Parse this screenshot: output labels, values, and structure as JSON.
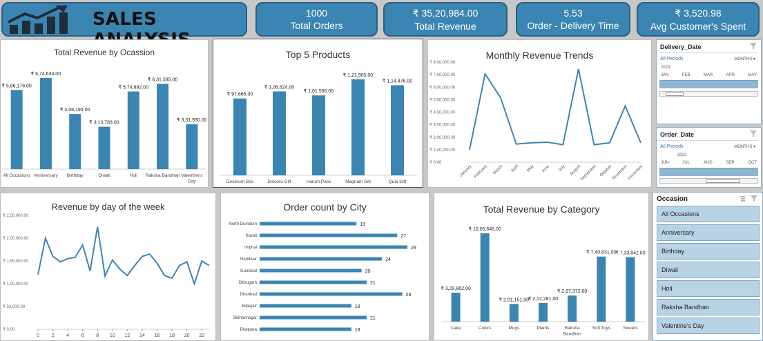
{
  "header": {
    "title": "SALES ANALYSIS",
    "kpis": [
      {
        "value": "1000",
        "label": "Total Orders"
      },
      {
        "value": "₹ 35,20,984.00",
        "label": "Total Revenue"
      },
      {
        "value": "5.53",
        "label": "Order - Delivery Time"
      },
      {
        "value": "₹ 3,520.98",
        "label": "Avg Customer's Spent"
      }
    ]
  },
  "colors": {
    "bar": "#3b85b2",
    "kpi_bg": "#3b85b2",
    "slicer_item": "#b9d3e6"
  },
  "charts": {
    "occasion": {
      "title": "Total Revenue by Ocassion",
      "categories": [
        "All Occasions",
        "Anniversary",
        "Birthday",
        "Diwali",
        "Holi",
        "Raksha Bandhan",
        "Valentine's Day"
      ],
      "values": [
        586176,
        674634,
        408194,
        313783,
        574682,
        631585,
        331930
      ],
      "labels": [
        "₹ 5,86,176.00",
        "₹ 6,74,634.00",
        "₹ 4,08,194.00",
        "₹ 3,13,783.00",
        "₹ 5,74,682.00",
        "₹ 6,31,585.00",
        "₹ 3,31,930.00"
      ]
    },
    "products": {
      "title": "Top 5 Products",
      "categories": [
        "Deserunt Box",
        "Dolores Gift",
        "Harum Pack",
        "Magnam Set",
        "Quia Gift"
      ],
      "values": [
        97665,
        106624,
        101556,
        121905,
        114476
      ],
      "labels": [
        "₹ 97,665.00",
        "₹ 1,06,624.00",
        "₹ 1,01,556.00",
        "₹ 1,21,905.00",
        "₹ 1,14,476.00"
      ]
    },
    "monthly": {
      "title": "Monthly Revenue Trends",
      "categories": [
        "January",
        "February",
        "March",
        "April",
        "May",
        "June",
        "July",
        "August",
        "September",
        "October",
        "November",
        "December"
      ],
      "values": [
        100000,
        705000,
        515000,
        145000,
        155000,
        160000,
        140000,
        745000,
        140000,
        155000,
        450000,
        155000
      ],
      "yticks": [
        "₹ 0.00",
        "₹ 1,00,000.00",
        "₹ 2,00,000.00",
        "₹ 3,00,000.00",
        "₹ 4,00,000.00",
        "₹ 5,00,000.00",
        "₹ 6,00,000.00",
        "₹ 7,00,000.00",
        "₹ 8,00,000.00"
      ],
      "ylim": [
        0,
        800000
      ]
    },
    "weekday": {
      "title": "Revenue by day of the week",
      "x": [
        0,
        1,
        2,
        3,
        4,
        5,
        6,
        7,
        8,
        9,
        10,
        11,
        12,
        13,
        14,
        15,
        16,
        17,
        18,
        19,
        20,
        21,
        22,
        23
      ],
      "values": [
        120000,
        200000,
        160000,
        148000,
        155000,
        158000,
        185000,
        128000,
        225000,
        117000,
        152000,
        132000,
        118000,
        140000,
        160000,
        165000,
        145000,
        118000,
        112000,
        140000,
        148000,
        100000,
        150000,
        140000
      ],
      "xticks": [
        "0",
        "2",
        "4",
        "6",
        "8",
        "10",
        "12",
        "14",
        "16",
        "18",
        "20",
        "22"
      ],
      "yticks": [
        "₹ 0.00",
        "₹ 50,000.00",
        "₹ 1,00,000.00",
        "₹ 1,50,000.00",
        "₹ 2,00,000.00",
        "₹ 2,50,000.00"
      ],
      "ylim": [
        0,
        250000
      ]
    },
    "city": {
      "title": "Order count by City",
      "categories": [
        "North Dumdum",
        "Kavali",
        "Imphal",
        "Haridwar",
        "Guntakal",
        "Dibrugarh",
        "Dhanbad",
        "Bilaspur",
        "Bidhannagar",
        "Bhatpara"
      ],
      "values": [
        19,
        27,
        29,
        24,
        20,
        21,
        28,
        18,
        21,
        18
      ],
      "labels": [
        "19",
        "27",
        "29",
        "24",
        "20",
        "21",
        "28",
        "18",
        "21",
        "18"
      ]
    },
    "category": {
      "title": "Total Revenue by Category",
      "categories": [
        "Cake",
        "Colors",
        "Mugs",
        "Plants",
        "Raksha Bandhan",
        "Soft Toys",
        "Sweets"
      ],
      "values": [
        329862,
        1005645,
        201151,
        212281,
        297372,
        740831,
        733842
      ],
      "labels": [
        "₹ 3,29,862.00",
        "₹ 10,05,645.00",
        "₹ 2,01,151.00",
        "₹ 2,12,281.00",
        "₹ 2,97,372.00",
        "₹ 7,40,831.00",
        "₹ 7,33,842.00"
      ]
    }
  },
  "chart_data": [
    {
      "type": "bar",
      "title": "Total Revenue by Ocassion",
      "categories": [
        "All Occasions",
        "Anniversary",
        "Birthday",
        "Diwali",
        "Holi",
        "Raksha Bandhan",
        "Valentine's Day"
      ],
      "values": [
        586176,
        674634,
        408194,
        313783,
        574682,
        631585,
        331930
      ]
    },
    {
      "type": "bar",
      "title": "Top 5 Products",
      "categories": [
        "Deserunt Box",
        "Dolores Gift",
        "Harum Pack",
        "Magnam Set",
        "Quia Gift"
      ],
      "values": [
        97665,
        106624,
        101556,
        121905,
        114476
      ]
    },
    {
      "type": "line",
      "title": "Monthly Revenue Trends",
      "x": [
        "January",
        "February",
        "March",
        "April",
        "May",
        "June",
        "July",
        "August",
        "September",
        "October",
        "November",
        "December"
      ],
      "values": [
        100000,
        705000,
        515000,
        145000,
        155000,
        160000,
        140000,
        745000,
        140000,
        155000,
        450000,
        155000
      ],
      "ylim": [
        0,
        800000
      ]
    },
    {
      "type": "line",
      "title": "Revenue by day of the week",
      "x": [
        0,
        1,
        2,
        3,
        4,
        5,
        6,
        7,
        8,
        9,
        10,
        11,
        12,
        13,
        14,
        15,
        16,
        17,
        18,
        19,
        20,
        21,
        22,
        23
      ],
      "values": [
        120000,
        200000,
        160000,
        148000,
        155000,
        158000,
        185000,
        128000,
        225000,
        117000,
        152000,
        132000,
        118000,
        140000,
        160000,
        165000,
        145000,
        118000,
        112000,
        140000,
        148000,
        100000,
        150000,
        140000
      ],
      "ylim": [
        0,
        250000
      ]
    },
    {
      "type": "bar",
      "title": "Order count by City",
      "categories": [
        "North Dumdum",
        "Kavali",
        "Imphal",
        "Haridwar",
        "Guntakal",
        "Dibrugarh",
        "Dhanbad",
        "Bilaspur",
        "Bidhannagar",
        "Bhatpara"
      ],
      "values": [
        19,
        27,
        29,
        24,
        20,
        21,
        28,
        18,
        21,
        18
      ]
    },
    {
      "type": "bar",
      "title": "Total Revenue by Category",
      "categories": [
        "Cake",
        "Colors",
        "Mugs",
        "Plants",
        "Raksha Bandhan",
        "Soft Toys",
        "Sweets"
      ],
      "values": [
        329862,
        1005645,
        201151,
        212281,
        297372,
        740831,
        733842
      ]
    }
  ],
  "slicers": {
    "delivery": {
      "title": "Delivery_Date",
      "period": "All Periods",
      "level": "MONTHS",
      "year": "2023",
      "months": [
        "JAN",
        "FEB",
        "MAR",
        "APR",
        "MAY"
      ]
    },
    "order": {
      "title": "Order_Date",
      "period": "All Periods",
      "level": "MONTHS",
      "year": "2023",
      "months": [
        "JUN",
        "JUL",
        "AUG",
        "SEP",
        "OCT"
      ]
    },
    "occasion": {
      "title": "Occasion",
      "items": [
        "All Occasions",
        "Anniversary",
        "Birthday",
        "Diwali",
        "Holi",
        "Raksha Bandhan",
        "Valentine's Day"
      ]
    }
  }
}
